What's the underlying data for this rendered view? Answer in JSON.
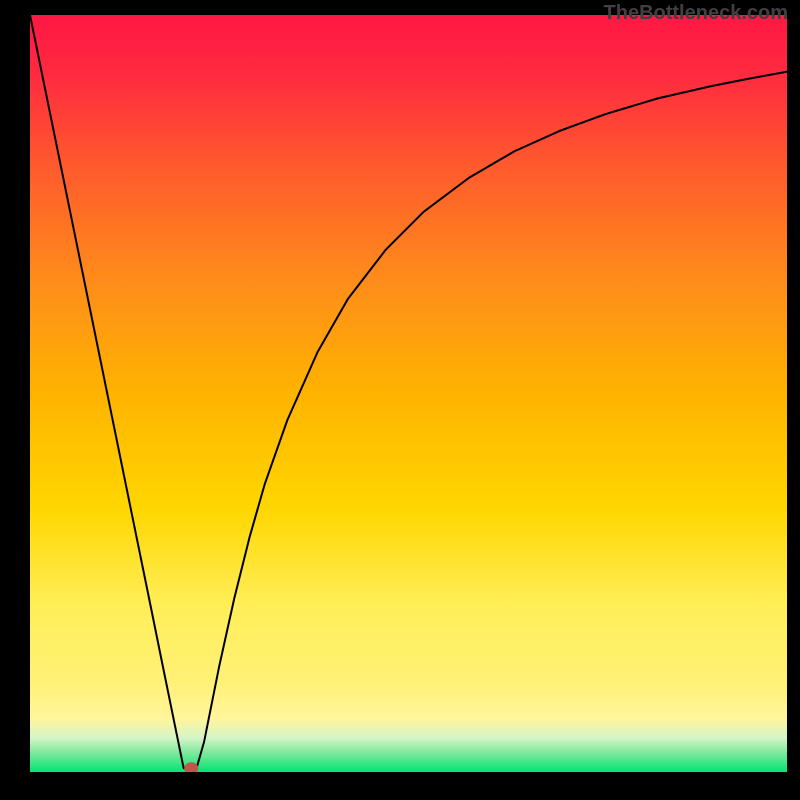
{
  "watermark": "TheBottleneck.com",
  "chart_data": {
    "type": "line",
    "title": "",
    "xlabel": "",
    "ylabel": "",
    "xlim": [
      0,
      100
    ],
    "ylim": [
      0,
      100
    ],
    "background": {
      "type": "vertical-gradient",
      "stops": [
        {
          "offset": 0.0,
          "color": "#ff1744"
        },
        {
          "offset": 0.08,
          "color": "#ff2b3f"
        },
        {
          "offset": 0.2,
          "color": "#ff5a2d"
        },
        {
          "offset": 0.35,
          "color": "#ff8c1a"
        },
        {
          "offset": 0.5,
          "color": "#ffb300"
        },
        {
          "offset": 0.65,
          "color": "#ffd600"
        },
        {
          "offset": 0.78,
          "color": "#ffee58"
        },
        {
          "offset": 0.88,
          "color": "#fff176"
        },
        {
          "offset": 0.93,
          "color": "#fff59d"
        },
        {
          "offset": 0.955,
          "color": "#d4f5c8"
        },
        {
          "offset": 0.975,
          "color": "#7de89a"
        },
        {
          "offset": 1.0,
          "color": "#00e676"
        }
      ]
    },
    "series": [
      {
        "name": "bottleneck-curve",
        "color": "#000000",
        "stroke_width": 2,
        "x": [
          0.0,
          2.0,
          4.0,
          6.0,
          8.0,
          10.0,
          12.0,
          14.0,
          16.0,
          17.5,
          18.5,
          19.5,
          20.3,
          21.3,
          22.0,
          23.0,
          25.0,
          27.0,
          29.0,
          31.0,
          34.0,
          38.0,
          42.0,
          47.0,
          52.0,
          58.0,
          64.0,
          70.0,
          76.0,
          83.0,
          90.0,
          95.0,
          100.0
        ],
        "y": [
          100.0,
          90.2,
          80.4,
          70.6,
          60.8,
          51.0,
          41.2,
          31.4,
          21.6,
          14.2,
          9.3,
          4.4,
          0.5,
          0.5,
          0.5,
          4.0,
          14.0,
          23.0,
          31.0,
          38.0,
          46.5,
          55.5,
          62.5,
          69.0,
          74.0,
          78.5,
          82.0,
          84.7,
          86.9,
          89.0,
          90.6,
          91.6,
          92.5
        ]
      }
    ],
    "marker": {
      "cx_frac": 0.213,
      "cy_frac": 0.995,
      "rx": 7,
      "ry": 6,
      "color": "#c0564a"
    }
  }
}
